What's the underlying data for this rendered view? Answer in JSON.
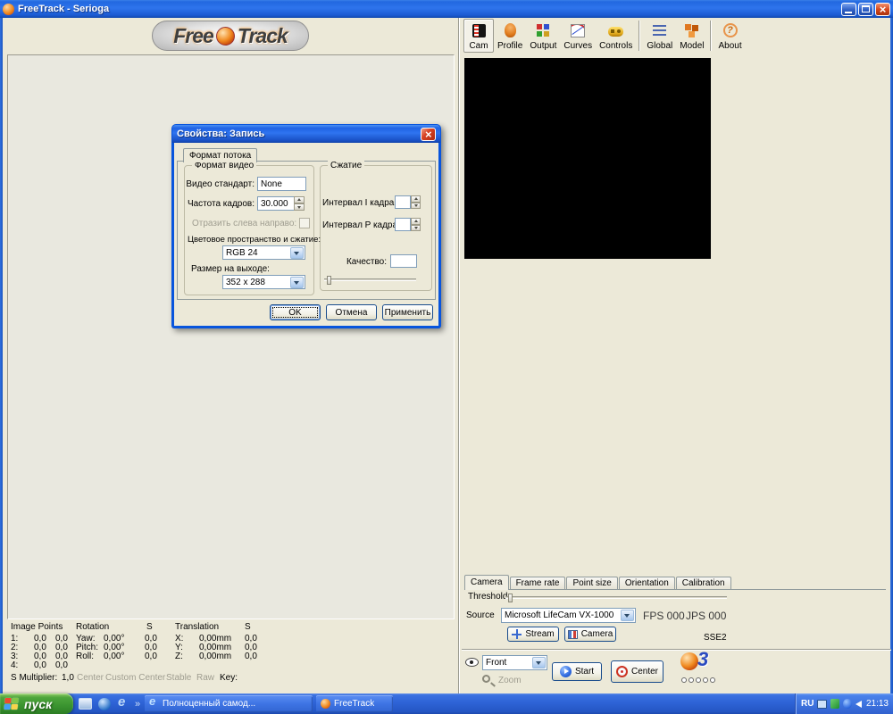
{
  "colors": {
    "titlebar_blue": "#2e74ec",
    "window_bg": "#ece9d8",
    "taskbar_blue": "#2e63d6",
    "start_green": "#3a9430",
    "dialog_border": "#0855dd",
    "video_bg": "#000000",
    "accent_orange": "#f08a20"
  },
  "window": {
    "title": "FreeTrack - Serioga"
  },
  "logo": {
    "free": "Free",
    "track": "Track"
  },
  "toolbar": {
    "items": [
      {
        "label": "Cam"
      },
      {
        "label": "Profile"
      },
      {
        "label": "Output"
      },
      {
        "label": "Curves"
      },
      {
        "label": "Controls"
      },
      {
        "label": "Global"
      },
      {
        "label": "Model"
      },
      {
        "label": "About"
      }
    ]
  },
  "camera_panel": {
    "tabs": [
      {
        "label": "Camera"
      },
      {
        "label": "Frame rate"
      },
      {
        "label": "Point size"
      },
      {
        "label": "Orientation"
      },
      {
        "label": "Calibration"
      }
    ],
    "threshold_label": "Threshold",
    "source_label": "Source",
    "source_value": "Microsoft LifeCam VX-1000",
    "fps_label": "FPS 000",
    "jps_label": "JPS 000",
    "stream_button": "Stream",
    "camera_button": "Camera",
    "instruction_set": "SSE2"
  },
  "control_bar": {
    "view_value": "Front",
    "zoom_label": "Zoom",
    "start_button": "Start",
    "center_button": "Center",
    "logo_number": "3"
  },
  "status": {
    "headers": {
      "image_points": "Image Points",
      "rotation": "Rotation",
      "s1": "S",
      "translation": "Translation",
      "s2": "S"
    },
    "points": [
      {
        "label": "1:",
        "x": "0,0",
        "y": "0,0"
      },
      {
        "label": "2:",
        "x": "0,0",
        "y": "0,0"
      },
      {
        "label": "3:",
        "x": "0,0",
        "y": "0,0"
      },
      {
        "label": "4:",
        "x": "0,0",
        "y": "0,0"
      }
    ],
    "rotation": [
      {
        "label": "Yaw:",
        "value": "0,00°",
        "s": "0,0"
      },
      {
        "label": "Pitch:",
        "value": "0,00°",
        "s": "0,0"
      },
      {
        "label": "Roll:",
        "value": "0,00°",
        "s": "0,0"
      }
    ],
    "translation": [
      {
        "label": "X:",
        "value": "0,00mm",
        "s": "0,0"
      },
      {
        "label": "Y:",
        "value": "0,00mm",
        "s": "0,0"
      },
      {
        "label": "Z:",
        "value": "0,00mm",
        "s": "0,0"
      }
    ],
    "multiplier_label": "S Multiplier:",
    "multiplier_value": "1,0",
    "center_label": "Center",
    "custom_center_label": "Custom Center",
    "stable_label": "Stable",
    "raw_label": "Raw",
    "key_label": "Key:"
  },
  "dialog": {
    "title": "Свойства: Запись",
    "tab_label": "Формат потока",
    "video_group_label": "Формат видео",
    "video_standard_label": "Видео стандарт:",
    "video_standard_value": "None",
    "frame_rate_label": "Частота кадров:",
    "frame_rate_value": "30.000",
    "flip_label": "Отразить слева направо:",
    "colorspace_label": "Цветовое пространство и сжатие:",
    "colorspace_value": "RGB 24",
    "output_size_label": "Размер на выходе:",
    "output_size_value": "352 x 288",
    "compression_group_label": "Сжатие",
    "i_interval_label": "Интервал I кадра:",
    "i_interval_value": "",
    "p_interval_label": "Интервал P кадра:",
    "p_interval_value": "",
    "quality_label": "Качество:",
    "quality_value": "",
    "ok_button": "OK",
    "cancel_button": "Отмена",
    "apply_button": "Применить"
  },
  "taskbar": {
    "start_label": "пуск",
    "tasks": [
      {
        "label": "Полноценный самод..."
      },
      {
        "label": "FreeTrack"
      }
    ],
    "language": "RU",
    "time": "21:13"
  }
}
